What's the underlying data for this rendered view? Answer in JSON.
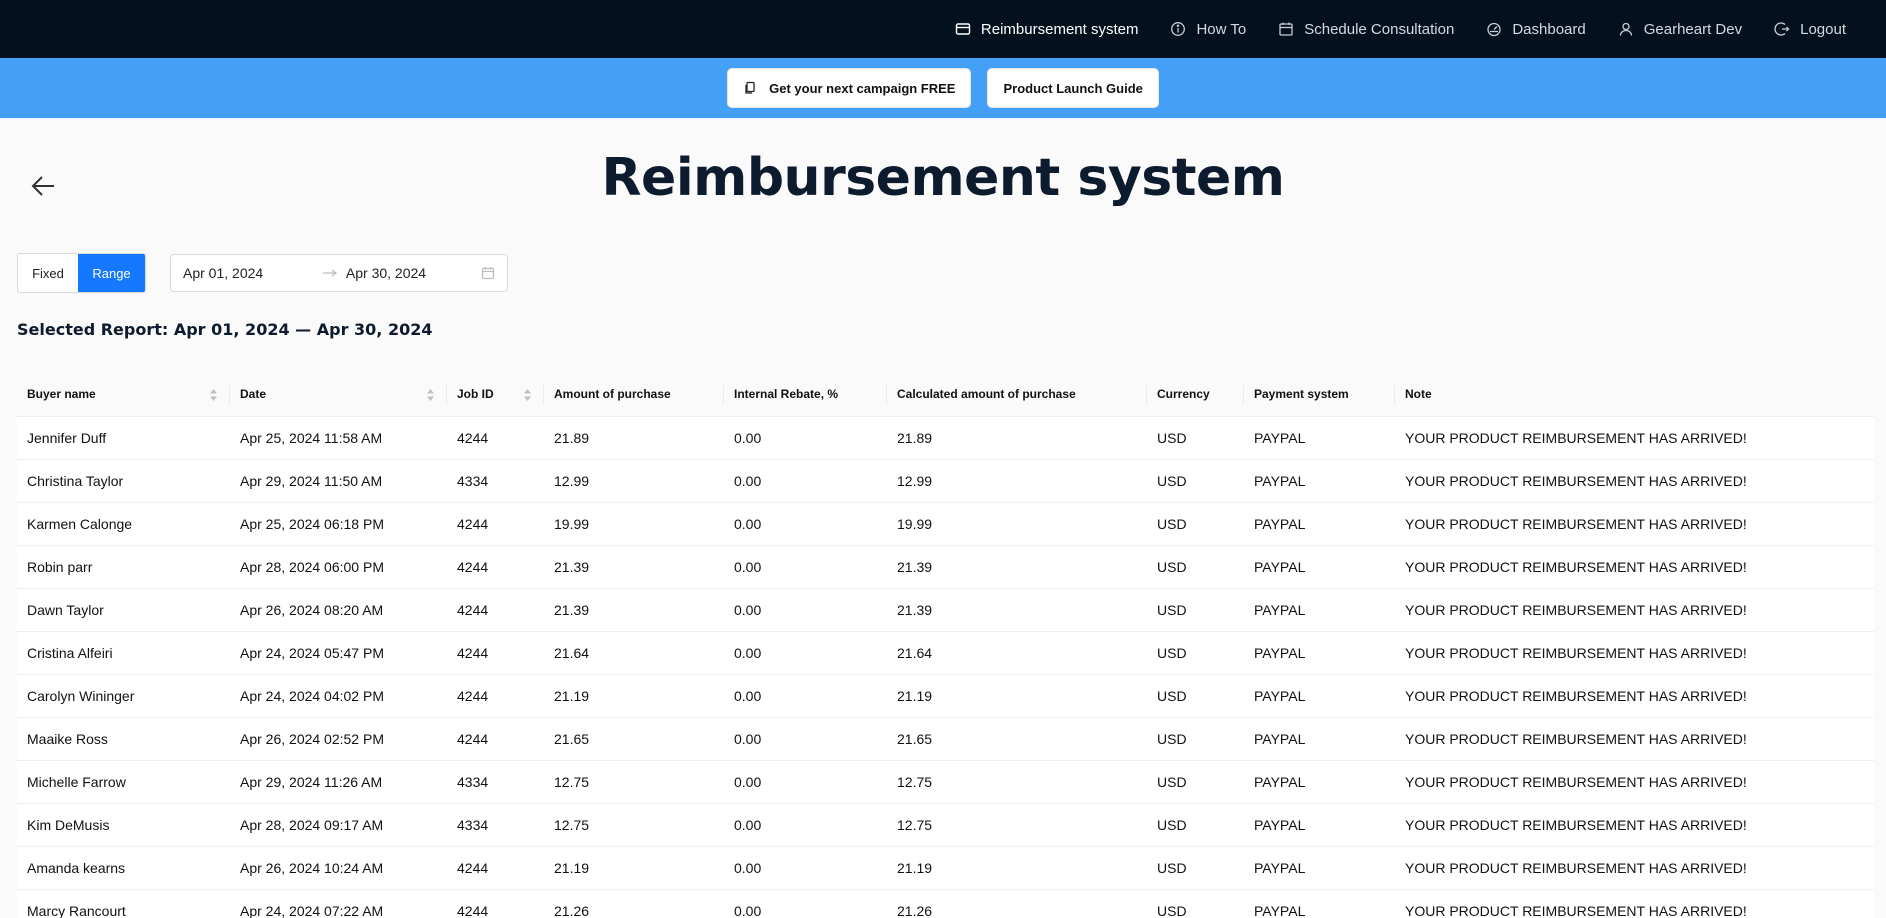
{
  "nav": {
    "items": [
      {
        "label": "Reimbursement system",
        "icon": "card-icon",
        "active": true
      },
      {
        "label": "How To",
        "icon": "info-icon"
      },
      {
        "label": "Schedule Consultation",
        "icon": "calendar-icon"
      },
      {
        "label": "Dashboard",
        "icon": "dashboard-icon"
      },
      {
        "label": "Gearheart Dev",
        "icon": "user-icon"
      },
      {
        "label": "Logout",
        "icon": "logout-icon"
      }
    ]
  },
  "promo": {
    "campaign_label": "Get your next campaign FREE",
    "guide_label": "Product Launch Guide",
    "bar_color": "#43a0f6"
  },
  "page": {
    "title": "Reimbursement system"
  },
  "filters": {
    "mode_fixed": "Fixed",
    "mode_range": "Range",
    "selected_mode": "Range",
    "start_date": "Apr 01, 2024",
    "end_date": "Apr 30, 2024"
  },
  "report": {
    "title": "Selected Report: Apr 01, 2024 — Apr 30, 2024"
  },
  "table": {
    "columns": [
      "Buyer name",
      "Date",
      "Job ID",
      "Amount of purchase",
      "Internal Rebate, %",
      "Calculated amount of purchase",
      "Currency",
      "Payment system",
      "Note"
    ],
    "rows": [
      [
        "Jennifer Duff",
        "Apr 25, 2024 11:58 AM",
        "4244",
        "21.89",
        "0.00",
        "21.89",
        "USD",
        "PAYPAL",
        "YOUR PRODUCT REIMBURSEMENT HAS ARRIVED!"
      ],
      [
        "Christina Taylor",
        "Apr 29, 2024 11:50 AM",
        "4334",
        "12.99",
        "0.00",
        "12.99",
        "USD",
        "PAYPAL",
        "YOUR PRODUCT REIMBURSEMENT HAS ARRIVED!"
      ],
      [
        "Karmen Calonge",
        "Apr 25, 2024 06:18 PM",
        "4244",
        "19.99",
        "0.00",
        "19.99",
        "USD",
        "PAYPAL",
        "YOUR PRODUCT REIMBURSEMENT HAS ARRIVED!"
      ],
      [
        "Robin parr",
        "Apr 28, 2024 06:00 PM",
        "4244",
        "21.39",
        "0.00",
        "21.39",
        "USD",
        "PAYPAL",
        "YOUR PRODUCT REIMBURSEMENT HAS ARRIVED!"
      ],
      [
        "Dawn Taylor",
        "Apr 26, 2024 08:20 AM",
        "4244",
        "21.39",
        "0.00",
        "21.39",
        "USD",
        "PAYPAL",
        "YOUR PRODUCT REIMBURSEMENT HAS ARRIVED!"
      ],
      [
        "Cristina Alfeiri",
        "Apr 24, 2024 05:47 PM",
        "4244",
        "21.64",
        "0.00",
        "21.64",
        "USD",
        "PAYPAL",
        "YOUR PRODUCT REIMBURSEMENT HAS ARRIVED!"
      ],
      [
        "Carolyn Wininger",
        "Apr 24, 2024 04:02 PM",
        "4244",
        "21.19",
        "0.00",
        "21.19",
        "USD",
        "PAYPAL",
        "YOUR PRODUCT REIMBURSEMENT HAS ARRIVED!"
      ],
      [
        "Maaike Ross",
        "Apr 26, 2024 02:52 PM",
        "4244",
        "21.65",
        "0.00",
        "21.65",
        "USD",
        "PAYPAL",
        "YOUR PRODUCT REIMBURSEMENT HAS ARRIVED!"
      ],
      [
        "Michelle Farrow",
        "Apr 29, 2024 11:26 AM",
        "4334",
        "12.75",
        "0.00",
        "12.75",
        "USD",
        "PAYPAL",
        "YOUR PRODUCT REIMBURSEMENT HAS ARRIVED!"
      ],
      [
        "Kim DeMusis",
        "Apr 28, 2024 09:17 AM",
        "4334",
        "12.75",
        "0.00",
        "12.75",
        "USD",
        "PAYPAL",
        "YOUR PRODUCT REIMBURSEMENT HAS ARRIVED!"
      ],
      [
        "Amanda kearns",
        "Apr 26, 2024 10:24 AM",
        "4244",
        "21.19",
        "0.00",
        "21.19",
        "USD",
        "PAYPAL",
        "YOUR PRODUCT REIMBURSEMENT HAS ARRIVED!"
      ],
      [
        "Marcy Rancourt",
        "Apr 24, 2024 07:22 AM",
        "4244",
        "21.26",
        "0.00",
        "21.26",
        "USD",
        "PAYPAL",
        "YOUR PRODUCT REIMBURSEMENT HAS ARRIVED!"
      ]
    ]
  }
}
